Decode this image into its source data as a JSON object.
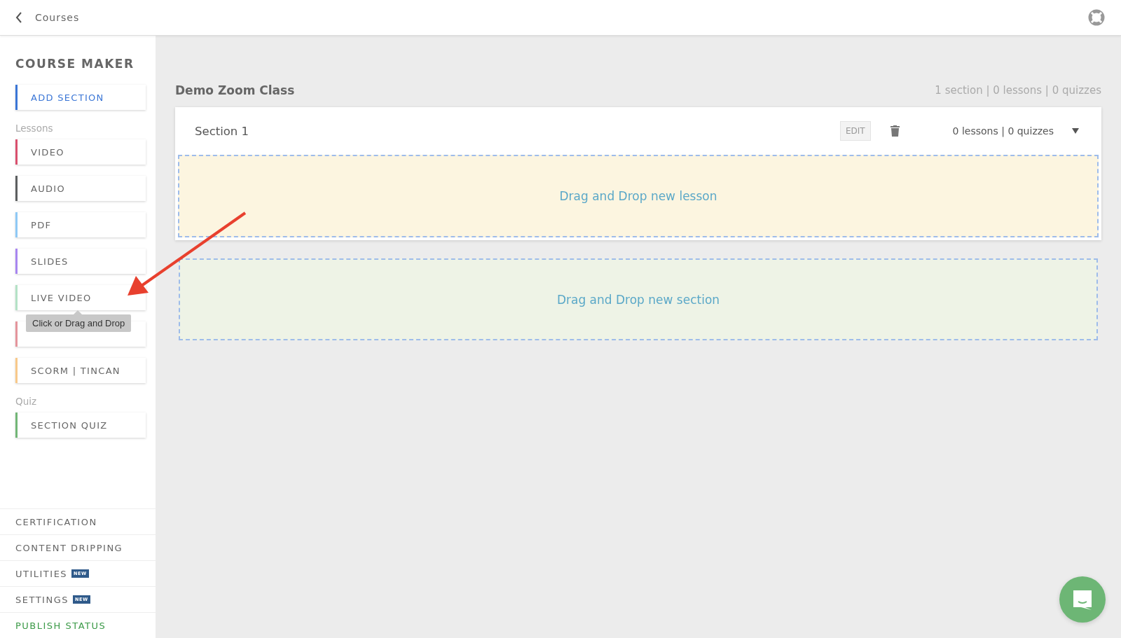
{
  "topbar": {
    "back_label": "Courses"
  },
  "sidebar": {
    "title": "COURSE MAKER",
    "add_section": {
      "label": "ADD SECTION",
      "color": "#3b76d6"
    },
    "groups": [
      {
        "heading": "Lessons",
        "items": [
          {
            "label": "VIDEO",
            "color": "#d9506e"
          },
          {
            "label": "AUDIO",
            "color": "#5c5f60"
          },
          {
            "label": "PDF",
            "color": "#8ec9f5"
          },
          {
            "label": "SLIDES",
            "color": "#a886f0"
          },
          {
            "label": "LIVE VIDEO",
            "color": "#b4e2c6",
            "tooltip": "Click or Drag and Drop"
          },
          {
            "color": "#e4959c"
          },
          {
            "label": "SCORM | TINCAN",
            "color": "#f8c98a"
          }
        ]
      },
      {
        "heading": "Quiz",
        "items": [
          {
            "label": "SECTION QUIZ",
            "color": "#72b677"
          }
        ]
      }
    ],
    "nav": [
      {
        "label": "CERTIFICATION",
        "kind": "plain"
      },
      {
        "label": "CONTENT DRIPPING",
        "kind": "plain"
      },
      {
        "label": "UTILITIES",
        "badge": "NEW",
        "kind": "plain"
      },
      {
        "label": "SETTINGS",
        "badge": "NEW",
        "kind": "plain"
      },
      {
        "label": "PUBLISH STATUS",
        "kind": "status"
      }
    ]
  },
  "course": {
    "title": "Demo Zoom Class",
    "summary": "1 section | 0 lessons | 0 quizzes",
    "sections": [
      {
        "title": "Section 1",
        "edit": "EDIT",
        "counts": "0 lessons | 0 quizzes",
        "expanded": true,
        "drop_hint": "Drag and Drop new lesson"
      }
    ],
    "new_section_hint": "Drag and Drop new section"
  }
}
